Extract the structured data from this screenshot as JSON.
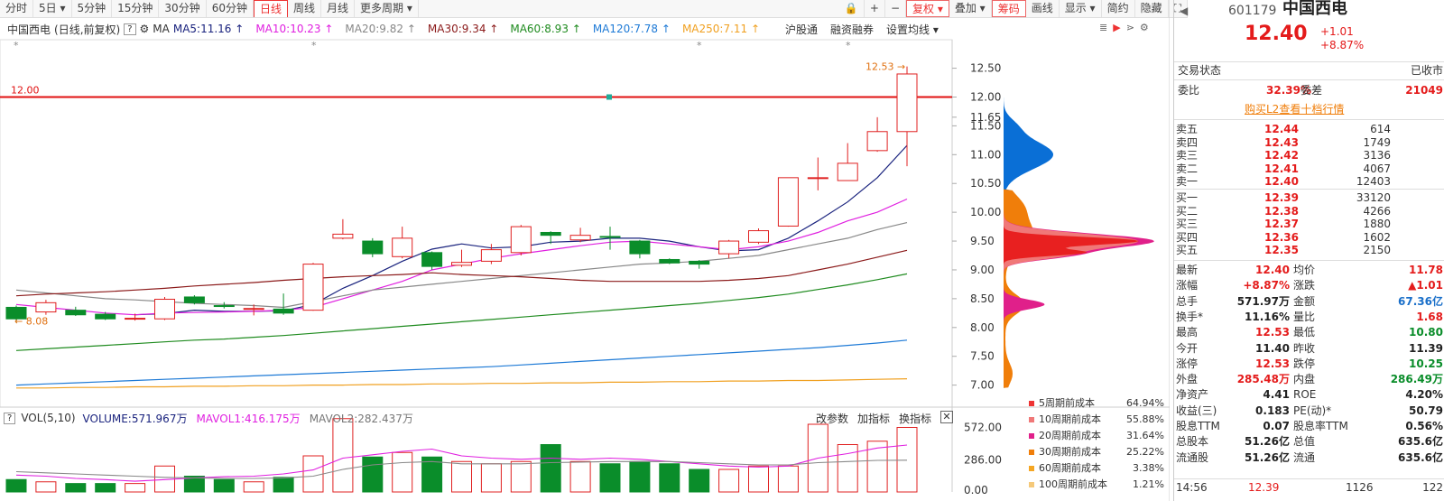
{
  "toolbar": {
    "periods": [
      "分时",
      "5日",
      "5分钟",
      "15分钟",
      "30分钟",
      "60分钟",
      "日线",
      "周线",
      "月线",
      "更多周期"
    ],
    "active": "日线",
    "right": [
      "复权",
      "叠加",
      "筹码",
      "画线",
      "显示",
      "简约",
      "隐藏"
    ]
  },
  "header": {
    "name": "中国西电",
    "adj": "(日线,前复权)",
    "ma_label": "MA",
    "ma": [
      {
        "text": "MA5:11.16",
        "color": "#1a237e"
      },
      {
        "text": "MA10:10.23",
        "color": "#e020e0"
      },
      {
        "text": "MA20:9.82",
        "color": "#888888"
      },
      {
        "text": "MA30:9.34",
        "color": "#8b1a1a"
      },
      {
        "text": "MA60:8.93",
        "color": "#1f8b1f"
      },
      {
        "text": "MA120:7.78",
        "color": "#1e7ad6"
      },
      {
        "text": "MA250:7.11",
        "color": "#f0a020"
      }
    ],
    "tools": [
      "沪股通",
      "融资融券",
      "设置均线"
    ]
  },
  "chart_data": {
    "type": "candlestick",
    "ylim": [
      6.9,
      12.65
    ],
    "yticks": [
      "12.50",
      "12.00",
      "11.65",
      "11.50",
      "11.00",
      "10.50",
      "10.00",
      "9.50",
      "9.00",
      "8.50",
      "8.00",
      "7.50",
      "7.00"
    ],
    "hline": {
      "value": 12.0,
      "label": "12.00"
    },
    "max_label": "12.53",
    "min_label": "8.08",
    "candles": [
      {
        "o": 8.35,
        "c": 8.15,
        "h": 8.38,
        "l": 8.08
      },
      {
        "o": 8.27,
        "c": 8.43,
        "h": 8.48,
        "l": 8.22
      },
      {
        "o": 8.3,
        "c": 8.22,
        "h": 8.36,
        "l": 8.2
      },
      {
        "o": 8.23,
        "c": 8.15,
        "h": 8.27,
        "l": 8.13
      },
      {
        "o": 8.15,
        "c": 8.16,
        "h": 8.24,
        "l": 8.12
      },
      {
        "o": 8.15,
        "c": 8.49,
        "h": 8.53,
        "l": 8.13
      },
      {
        "o": 8.53,
        "c": 8.43,
        "h": 8.56,
        "l": 8.4
      },
      {
        "o": 8.38,
        "c": 8.37,
        "h": 8.44,
        "l": 8.33
      },
      {
        "o": 8.32,
        "c": 8.33,
        "h": 8.4,
        "l": 8.21
      },
      {
        "o": 8.32,
        "c": 8.25,
        "h": 8.59,
        "l": 8.22
      },
      {
        "o": 8.3,
        "c": 9.1,
        "h": 9.12,
        "l": 8.29
      },
      {
        "o": 9.55,
        "c": 9.62,
        "h": 9.88,
        "l": 9.53
      },
      {
        "o": 9.5,
        "c": 9.28,
        "h": 9.55,
        "l": 9.22
      },
      {
        "o": 9.23,
        "c": 9.55,
        "h": 9.75,
        "l": 9.2
      },
      {
        "o": 9.3,
        "c": 9.06,
        "h": 9.32,
        "l": 9.0
      },
      {
        "o": 9.08,
        "c": 9.13,
        "h": 9.35,
        "l": 9.05
      },
      {
        "o": 9.15,
        "c": 9.35,
        "h": 9.45,
        "l": 9.1
      },
      {
        "o": 9.3,
        "c": 9.75,
        "h": 9.78,
        "l": 9.25
      },
      {
        "o": 9.65,
        "c": 9.6,
        "h": 9.67,
        "l": 9.45
      },
      {
        "o": 9.52,
        "c": 9.6,
        "h": 9.73,
        "l": 9.48
      },
      {
        "o": 9.58,
        "c": 9.57,
        "h": 9.75,
        "l": 9.35
      },
      {
        "o": 9.5,
        "c": 9.28,
        "h": 9.52,
        "l": 9.2
      },
      {
        "o": 9.18,
        "c": 9.12,
        "h": 9.2,
        "l": 9.1
      },
      {
        "o": 9.15,
        "c": 9.1,
        "h": 9.17,
        "l": 9.02
      },
      {
        "o": 9.28,
        "c": 9.5,
        "h": 9.52,
        "l": 9.2
      },
      {
        "o": 9.48,
        "c": 9.68,
        "h": 9.72,
        "l": 9.45
      },
      {
        "o": 9.76,
        "c": 10.6,
        "h": 10.6,
        "l": 9.75
      },
      {
        "o": 10.6,
        "c": 10.6,
        "h": 10.95,
        "l": 10.38
      },
      {
        "o": 10.55,
        "c": 10.85,
        "h": 11.2,
        "l": 10.55
      },
      {
        "o": 11.07,
        "c": 11.4,
        "h": 11.65,
        "l": 11.05
      },
      {
        "o": 11.4,
        "c": 12.4,
        "h": 12.53,
        "l": 10.8
      }
    ],
    "volumes": [
      110,
      90,
      75,
      75,
      75,
      230,
      140,
      110,
      90,
      130,
      320,
      650,
      310,
      350,
      310,
      270,
      250,
      270,
      420,
      270,
      250,
      270,
      250,
      200,
      200,
      230,
      230,
      600,
      420,
      450,
      572
    ],
    "vol_ylim": [
      0,
      600
    ],
    "vol_ticks": [
      "572.00",
      "286.00",
      "0.00"
    ],
    "ma_series": [
      {
        "name": "MA5",
        "color": "#1a237e",
        "values": [
          null,
          null,
          null,
          null,
          8.22,
          8.24,
          8.3,
          8.28,
          8.28,
          8.29,
          8.4,
          8.68,
          8.9,
          9.15,
          9.36,
          9.45,
          9.38,
          9.4,
          9.48,
          9.5,
          9.55,
          9.55,
          9.5,
          9.4,
          9.33,
          9.35,
          9.55,
          9.85,
          10.18,
          10.6,
          11.16
        ]
      },
      {
        "name": "MA10",
        "color": "#e020e0",
        "values": [
          8.4,
          8.35,
          8.3,
          8.25,
          8.22,
          8.25,
          8.26,
          8.27,
          8.28,
          8.3,
          8.35,
          8.5,
          8.65,
          8.8,
          9.0,
          9.1,
          9.2,
          9.28,
          9.35,
          9.42,
          9.48,
          9.5,
          9.45,
          9.4,
          9.35,
          9.4,
          9.5,
          9.65,
          9.85,
          10.0,
          10.23
        ]
      },
      {
        "name": "MA20",
        "color": "#888888",
        "values": [
          8.65,
          8.6,
          8.55,
          8.5,
          8.48,
          8.45,
          8.42,
          8.4,
          8.38,
          8.35,
          8.45,
          8.55,
          8.65,
          8.7,
          8.75,
          8.8,
          8.85,
          8.9,
          8.95,
          9.0,
          9.05,
          9.1,
          9.12,
          9.15,
          9.2,
          9.25,
          9.35,
          9.45,
          9.55,
          9.7,
          9.82
        ]
      },
      {
        "name": "MA30",
        "color": "#8b1a1a",
        "values": [
          8.55,
          8.58,
          8.6,
          8.62,
          8.65,
          8.68,
          8.72,
          8.75,
          8.78,
          8.82,
          8.85,
          8.88,
          8.9,
          8.92,
          8.95,
          8.92,
          8.9,
          8.88,
          8.85,
          8.82,
          8.8,
          8.8,
          8.8,
          8.8,
          8.82,
          8.85,
          8.9,
          9.0,
          9.1,
          9.22,
          9.34
        ]
      },
      {
        "name": "MA60",
        "color": "#1f8b1f",
        "values": [
          7.6,
          7.63,
          7.66,
          7.69,
          7.72,
          7.75,
          7.78,
          7.8,
          7.83,
          7.86,
          7.9,
          7.94,
          7.98,
          8.02,
          8.06,
          8.1,
          8.14,
          8.18,
          8.22,
          8.26,
          8.3,
          8.34,
          8.38,
          8.42,
          8.47,
          8.52,
          8.58,
          8.66,
          8.74,
          8.83,
          8.93
        ]
      },
      {
        "name": "MA120",
        "color": "#1e7ad6",
        "values": [
          7.0,
          7.02,
          7.04,
          7.06,
          7.08,
          7.1,
          7.12,
          7.14,
          7.16,
          7.18,
          7.2,
          7.22,
          7.24,
          7.26,
          7.28,
          7.3,
          7.32,
          7.35,
          7.38,
          7.41,
          7.44,
          7.47,
          7.5,
          7.53,
          7.56,
          7.59,
          7.62,
          7.65,
          7.69,
          7.73,
          7.78
        ]
      },
      {
        "name": "MA250",
        "color": "#f0a020",
        "values": [
          6.95,
          6.95,
          6.96,
          6.96,
          6.97,
          6.97,
          6.98,
          6.98,
          6.99,
          6.99,
          7.0,
          7.0,
          7.01,
          7.01,
          7.02,
          7.02,
          7.03,
          7.03,
          7.04,
          7.04,
          7.05,
          7.05,
          7.06,
          7.06,
          7.07,
          7.07,
          7.08,
          7.08,
          7.09,
          7.1,
          7.11
        ]
      }
    ],
    "vol_ma": [
      {
        "name": "MAVOL1",
        "color": "#e020e0",
        "values": [
          150,
          140,
          120,
          110,
          95,
          110,
          125,
          135,
          140,
          160,
          195,
          300,
          330,
          360,
          380,
          320,
          300,
          290,
          300,
          290,
          300,
          290,
          270,
          250,
          230,
          220,
          230,
          300,
          340,
          390,
          416
        ]
      },
      {
        "name": "MAVOL2",
        "color": "#888888",
        "values": [
          180,
          170,
          160,
          150,
          140,
          130,
          125,
          120,
          120,
          125,
          140,
          200,
          240,
          260,
          270,
          250,
          250,
          250,
          260,
          265,
          270,
          270,
          270,
          260,
          250,
          240,
          240,
          260,
          270,
          280,
          282
        ]
      }
    ]
  },
  "volume_header": {
    "label": "VOL(5,10)",
    "volume": "VOLUME:571.967万",
    "mavol1": "MAVOL1:416.175万",
    "mavol2": "MAVOL2:282.437万",
    "tools": [
      "改参数",
      "加指标",
      "换指标"
    ]
  },
  "chip_legend": [
    {
      "label": "5周期前成本",
      "pct": "64.94%",
      "color": "#e33"
    },
    {
      "label": "10周期前成本",
      "pct": "55.88%",
      "color": "#f07878"
    },
    {
      "label": "20周期前成本",
      "pct": "31.64%",
      "color": "#e0208a"
    },
    {
      "label": "30周期前成本",
      "pct": "25.22%",
      "color": "#f07e0a"
    },
    {
      "label": "60周期前成本",
      "pct": "3.38%",
      "color": "#f5a623"
    },
    {
      "label": "100周期前成本",
      "pct": "1.21%",
      "color": "#f5c97a"
    }
  ],
  "quote": {
    "code": "601179",
    "name": "中国西电",
    "price": "12.40",
    "change": "+1.01",
    "pct": "+8.87%",
    "status_label": "交易状态",
    "status": "已收市",
    "weibi_label": "委比",
    "weibi": "32.39%",
    "weicha_label": "委差",
    "weicha": "21049",
    "l2_link": "购买L2查看十档行情",
    "asks": [
      {
        "label": "卖五",
        "price": "12.44",
        "vol": "614"
      },
      {
        "label": "卖四",
        "price": "12.43",
        "vol": "1749"
      },
      {
        "label": "卖三",
        "price": "12.42",
        "vol": "3136"
      },
      {
        "label": "卖二",
        "price": "12.41",
        "vol": "4067"
      },
      {
        "label": "卖一",
        "price": "12.40",
        "vol": "12403"
      }
    ],
    "bids": [
      {
        "label": "买一",
        "price": "12.39",
        "vol": "33120"
      },
      {
        "label": "买二",
        "price": "12.38",
        "vol": "4266"
      },
      {
        "label": "买三",
        "price": "12.37",
        "vol": "1880"
      },
      {
        "label": "买四",
        "price": "12.36",
        "vol": "1602"
      },
      {
        "label": "买五",
        "price": "12.35",
        "vol": "2150"
      }
    ],
    "stats": [
      {
        "l1": "最新",
        "v1": "12.40",
        "c1": "up",
        "l2": "均价",
        "v2": "11.78",
        "c2": "up"
      },
      {
        "l1": "涨幅",
        "v1": "+8.87%",
        "c1": "up",
        "l2": "涨跌",
        "v2": "▲1.01",
        "c2": "up"
      },
      {
        "l1": "总手",
        "v1": "571.97万",
        "c1": "",
        "l2": "金额",
        "v2": "67.36亿",
        "c2": "blue"
      },
      {
        "l1": "换手*",
        "v1": "11.16%",
        "c1": "",
        "l2": "量比",
        "v2": "1.68",
        "c2": "up"
      },
      {
        "l1": "最高",
        "v1": "12.53",
        "c1": "up",
        "l2": "最低",
        "v2": "10.80",
        "c2": "dn"
      },
      {
        "l1": "今开",
        "v1": "11.40",
        "c1": "",
        "l2": "昨收",
        "v2": "11.39",
        "c2": ""
      },
      {
        "l1": "涨停",
        "v1": "12.53",
        "c1": "up",
        "l2": "跌停",
        "v2": "10.25",
        "c2": "dn"
      },
      {
        "l1": "外盘",
        "v1": "285.48万",
        "c1": "up",
        "l2": "内盘",
        "v2": "286.49万",
        "c2": "dn"
      },
      {
        "l1": "净资产",
        "v1": "4.41",
        "c1": "",
        "l2": "ROE",
        "v2": "4.20%",
        "c2": ""
      },
      {
        "l1": "收益(三)",
        "v1": "0.183",
        "c1": "",
        "l2": "PE(动)*",
        "v2": "50.79",
        "c2": ""
      },
      {
        "l1": "股息TTM",
        "v1": "0.07",
        "c1": "",
        "l2": "股息率TTM",
        "v2": "0.56%",
        "c2": ""
      },
      {
        "l1": "总股本",
        "v1": "51.26亿",
        "c1": "",
        "l2": "总值",
        "v2": "635.6亿",
        "c2": ""
      },
      {
        "l1": "流通股",
        "v1": "51.26亿",
        "c1": "",
        "l2": "流通",
        "v2": "635.6亿",
        "c2": ""
      }
    ],
    "tick": {
      "time": "14:56",
      "price": "12.39",
      "vol": "1126",
      "n": "122"
    }
  }
}
